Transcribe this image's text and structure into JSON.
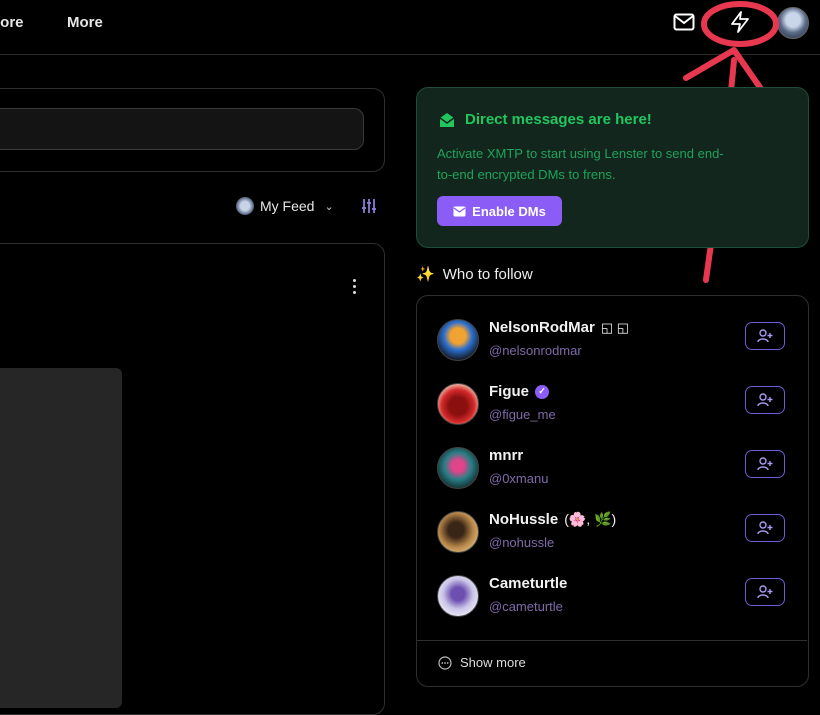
{
  "nav": {
    "explore_label": "lore",
    "more_label": "More"
  },
  "feed": {
    "selector_label": "My Feed"
  },
  "dm_banner": {
    "title": "Direct messages are here!",
    "body": "Activate XMTP to start using Lenster to send end-to-end encrypted DMs to frens.",
    "button_label": "Enable DMs"
  },
  "who_to_follow": {
    "heading": "Who to follow",
    "profiles": [
      {
        "name": "NelsonRodMar",
        "name_suffix": "◱ ◱",
        "handle": "@nelsonrodmar",
        "avatar_color": "#2b6fd1"
      },
      {
        "name": "Figue",
        "name_suffix": "",
        "handle": "@figue_me",
        "avatar_color": "#c21f1f",
        "verified": true
      },
      {
        "name": "mnrr",
        "name_suffix": "",
        "handle": "@0xmanu",
        "avatar_color": "#2a7f86"
      },
      {
        "name": "NoHussle",
        "name_suffix": "(🌸, 🌿)",
        "handle": "@nohussle",
        "avatar_color": "#b7864a"
      },
      {
        "name": "Cameturtle",
        "name_suffix": "",
        "handle": "@cameturtle",
        "avatar_color": "#c9c4e6"
      }
    ],
    "show_more_label": "Show more"
  },
  "colors": {
    "accent": "#8b5cf6",
    "dm_green": "#22c55e",
    "annotation_red": "#e8384f"
  },
  "icons": [
    "mail-icon",
    "lightning-icon",
    "chevron-down-icon",
    "filter-icon",
    "kebab-icon",
    "sparkles-icon",
    "user-plus-icon",
    "envelope-open-icon"
  ]
}
